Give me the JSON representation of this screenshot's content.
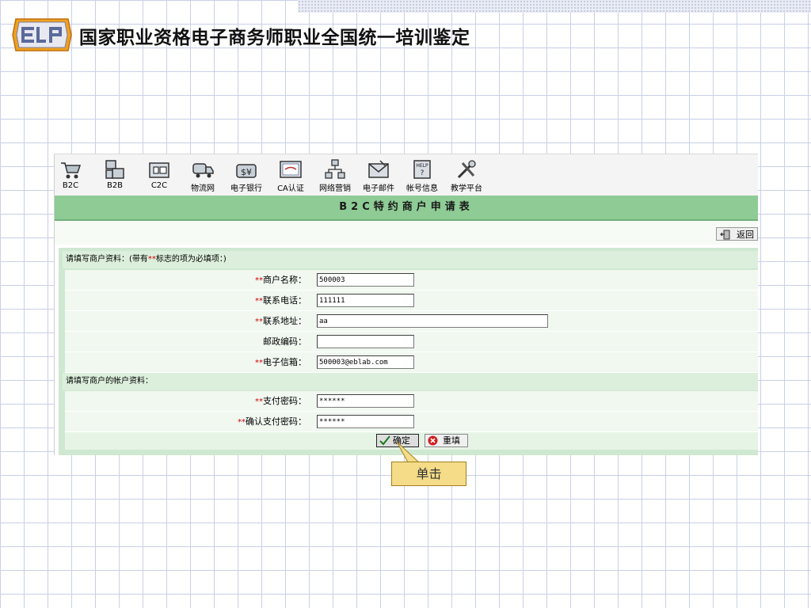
{
  "header": {
    "logo_text": "ELP",
    "title": "国家职业资格电子商务师职业全国统一培训鉴定"
  },
  "toolbar": {
    "items": [
      {
        "label": "B2C",
        "icon": "shopping-cart-icon"
      },
      {
        "label": "B2B",
        "icon": "buildings-icon"
      },
      {
        "label": "C2C",
        "icon": "bed-icon"
      },
      {
        "label": "物流网",
        "icon": "truck-icon"
      },
      {
        "label": "电子银行",
        "icon": "money-bag-icon"
      },
      {
        "label": "CA认证",
        "icon": "certificate-icon"
      },
      {
        "label": "网络营销",
        "icon": "network-icon"
      },
      {
        "label": "电子邮件",
        "icon": "mail-icon"
      },
      {
        "label": "帐号信息",
        "icon": "help-book-icon"
      },
      {
        "label": "教学平台",
        "icon": "tools-icon"
      }
    ]
  },
  "page": {
    "title": "B2C特约商户申请表",
    "back_label": "返回"
  },
  "form": {
    "section1": "请填写商户资料：(带有**标志的项为必填项：)",
    "section1_parts": {
      "before": "请填写商户资料：(带有",
      "mark": "**",
      "after": "标志的项为必填项：)"
    },
    "section2": "请填写商户的帐户资料：",
    "req_mark": "**",
    "fields": [
      {
        "label": "商户名称：",
        "value": "500003",
        "required": true
      },
      {
        "label": "联系电话：",
        "value": "111111",
        "required": true
      },
      {
        "label": "联系地址：",
        "value": "aa",
        "required": true
      },
      {
        "label": "邮政编码：",
        "value": "",
        "required": false
      },
      {
        "label": "电子信箱：",
        "value": "500003@eblab.com",
        "required": true
      },
      {
        "label": "支付密码：",
        "value": "******",
        "required": true
      },
      {
        "label": "确认支付密码：",
        "value": "******",
        "required": true
      }
    ],
    "confirm_label": "确定",
    "reset_label": "重填"
  },
  "annotation": {
    "callout_text": "单击"
  },
  "colors": {
    "title_bar": "#8ecb95",
    "form_bg": "#cfe8d1",
    "required_mark": "#cc0000",
    "callout": "#f4dc88"
  }
}
